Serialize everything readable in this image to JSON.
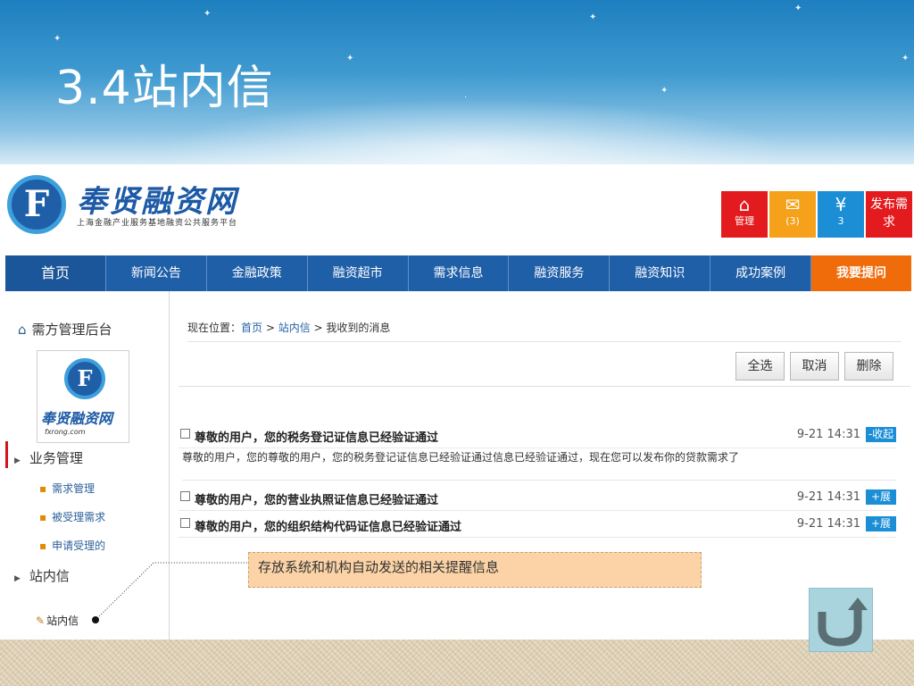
{
  "slide": {
    "title": "3.4站内信"
  },
  "site": {
    "name": "奉贤融资网",
    "tagline": "上海金融产业服务基地融资公共服务平台",
    "logo_letter": "F",
    "quick_buttons": [
      {
        "icon": "home-icon",
        "label": "管理",
        "color": "#e31b1e"
      },
      {
        "icon": "mail-icon",
        "label": "(3)",
        "color": "#f5a21a"
      },
      {
        "icon": "yen-icon",
        "label": "3",
        "color": "#1b8ed6"
      },
      {
        "label": "发布需求",
        "color": "#e31b1e"
      }
    ],
    "nav": [
      "首页",
      "新闻公告",
      "金融政策",
      "融资超市",
      "需求信息",
      "融资服务",
      "融资知识",
      "成功案例",
      "我要提问"
    ]
  },
  "sidebar": {
    "title": "需方管理后台",
    "logo_name": "奉贤融资网",
    "logo_domain": "fxrong.com",
    "sections": [
      {
        "label": "业务管理",
        "items": [
          "需求管理",
          "被受理需求",
          "申请受理的"
        ]
      },
      {
        "label": "站内信",
        "items": [
          "站内信"
        ]
      }
    ]
  },
  "main": {
    "breadcrumb": {
      "prefix": "现在位置：",
      "home": "首页",
      "sep1": " > ",
      "inbox": "站内信",
      "sep2": " > ",
      "current": "我收到的消息"
    },
    "buttons": [
      "全选",
      "取消",
      "删除"
    ],
    "messages": [
      {
        "subject": "尊敬的用户，您的税务登记证信息已经验证通过",
        "time": "9-21 14:31",
        "toggle": "-收起"
      },
      {
        "subject": "尊敬的用户，您的营业执照证信息已经验证通过",
        "time": "9-21 14:31",
        "toggle": "+展开"
      },
      {
        "subject": "尊敬的用户，您的组织结构代码证信息已经验证通过",
        "time": "9-21 14:31",
        "toggle": "+展开"
      }
    ],
    "expanded_body": "尊敬的用户，您的尊敬的用户，您的税务登记证信息已经验证通过信息已经验证通过，现在您可以发布你的贷款需求了"
  },
  "callout": {
    "text": "存放系统和机构自动发送的相关提醒信息"
  },
  "colors": {
    "nav_blue": "#1f5fa8",
    "ask_orange": "#f06b0a",
    "toggle_blue": "#1b8ed6",
    "callout_bg": "#fbd3a6"
  }
}
